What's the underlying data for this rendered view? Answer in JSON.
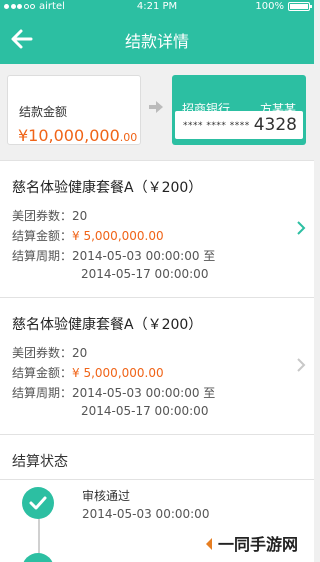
{
  "status_bar": {
    "carrier": "airtel",
    "time": "4:21 PM",
    "battery_text": "100%",
    "battery_level": 1.0
  },
  "nav": {
    "title": "结款详情"
  },
  "summary": {
    "amount_label": "结款金额",
    "amount_main": "¥10,000,000",
    "amount_cents": ".00",
    "bank_name": "招商银行",
    "account_holder": "方某某",
    "card_masked": "**** **** ****",
    "card_last4": "4328"
  },
  "items": [
    {
      "title": "慈名体验健康套餐A（￥200）",
      "voucher_label": "美团券数：",
      "voucher_count": "20",
      "amount_label": "结算金额：",
      "amount": "¥ 5,000,000.00",
      "period_label": "结算周期：",
      "period_start": "2014-05-03 00:00:00 至",
      "period_end": "2014-05-17 00:00:00"
    },
    {
      "title": "慈名体验健康套餐A（￥200）",
      "voucher_label": "美团券数：",
      "voucher_count": "20",
      "amount_label": "结算金额：",
      "amount": "¥ 5,000,000.00",
      "period_label": "结算周期：",
      "period_start": "2014-05-03 00:00:00 至",
      "period_end": "2014-05-17 00:00:00"
    }
  ],
  "settlement_status": {
    "title": "结算状态",
    "steps": [
      {
        "label": "审核通过",
        "date": "2014-05-03 00:00:00"
      }
    ]
  },
  "watermark": {
    "text": "一同手游网"
  },
  "colors": {
    "accent": "#2cbfa2",
    "amount": "#f06418"
  }
}
